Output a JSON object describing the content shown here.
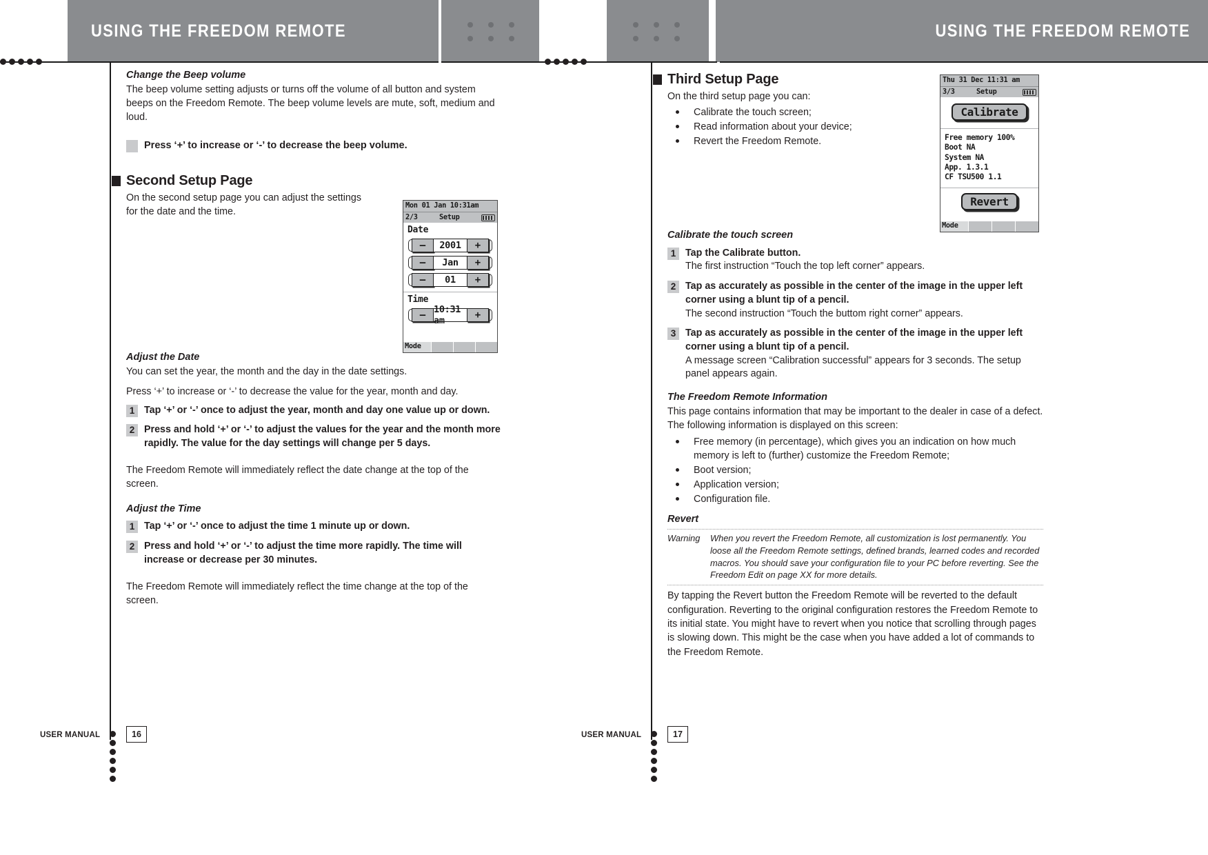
{
  "header": {
    "left_title": "USING THE FREEDOM REMOTE",
    "right_title": "USING THE FREEDOM REMOTE"
  },
  "left_page": {
    "beep": {
      "heading": "Change the Beep volume",
      "paragraph": "The beep volume setting adjusts or turns off the volume of all button and system beeps on the Freedom Remote. The beep volume levels are mute, soft, medium and loud.",
      "note": "Press ‘+’ to increase or ‘-’ to decrease the beep volume."
    },
    "second_setup": {
      "heading": "Second Setup Page",
      "paragraph": "On the second setup page you can adjust the settings for the date and the time."
    },
    "adjust_date": {
      "heading": "Adjust the Date",
      "paragraph1": "You can set the year, the month and the day in the date settings.",
      "paragraph2": "Press ‘+’ to increase or ‘-’ to decrease the value for the year, month and day.",
      "steps": [
        {
          "num": "1",
          "lead": "Tap ‘+’ or ‘-’ once to adjust the year, month and day one value up or down."
        },
        {
          "num": "2",
          "lead": "Press and hold ‘+’ or ‘-’ to adjust the values for the year and the month more rapidly. The value for the day settings will change per 5 days."
        }
      ],
      "closing": "The Freedom Remote will immediately reflect the date change at the top of the screen."
    },
    "adjust_time": {
      "heading": "Adjust the Time",
      "steps": [
        {
          "num": "1",
          "lead": "Tap ‘+’ or ‘-’ once to adjust the time 1 minute up or down."
        },
        {
          "num": "2",
          "lead": "Press and hold ‘+’ or ‘-’ to adjust the time more rapidly. The time will increase or decrease per 30 minutes."
        }
      ],
      "closing": "The Freedom Remote will immediately reflect the time change at the top of the screen."
    },
    "lcd": {
      "statusbar": "Mon 01 Jan  10:31am",
      "page_indicator": "2/3",
      "page_title": "Setup",
      "date_label": "Date",
      "year": "2001",
      "month": "Jan",
      "day": "01",
      "time_label": "Time",
      "time": "10:31 am",
      "minus": "–",
      "plus": "+",
      "mode": "Mode"
    }
  },
  "right_page": {
    "third_setup": {
      "heading": "Third Setup Page",
      "paragraph": "On the third setup page you can:",
      "bullets": [
        "Calibrate the touch screen;",
        "Read information about your device;",
        "Revert the Freedom Remote."
      ]
    },
    "calibrate": {
      "heading": "Calibrate the touch screen",
      "steps": [
        {
          "num": "1",
          "lead": "Tap the Calibrate button.",
          "sub": "The first instruction “Touch the top left corner” appears."
        },
        {
          "num": "2",
          "lead": "Tap as accurately as possible in the center of the image in the upper left corner using a blunt tip of a pencil.",
          "sub": "The second instruction “Touch the buttom right corner” appears."
        },
        {
          "num": "3",
          "lead": "Tap as accurately as possible in the center of the image in the upper left corner using a blunt tip of a pencil.",
          "sub": "A message screen “Calibration successful” appears for 3 seconds. The setup panel appears again."
        }
      ]
    },
    "information": {
      "heading": "The Freedom Remote Information",
      "paragraph": "This page contains information that may be important to the dealer in case of a defect. The following information is displayed on this screen:",
      "bullets": [
        "Free memory (in percentage), which gives you an indication on how much memory is left to (further) customize the Freedom Remote;",
        "Boot version;",
        "Application version;",
        "Configuration file."
      ]
    },
    "revert": {
      "heading": "Revert",
      "warning_label": "Warning",
      "warning_text": "When you revert the Freedom Remote, all customization is lost permanently. You loose all the Freedom Remote settings, defined brands, learned codes and recorded macros. You should save your configuration file to your PC before reverting. See the Freedom Edit on page XX for more details.",
      "paragraph": "By tapping the Revert button the Freedom Remote will be reverted to the default configuration. Reverting to the original configuration restores the Freedom Remote to its initial state. You might have to revert when you notice that scrolling through pages is slowing down. This might be the case when you have added a lot of commands to the Freedom Remote."
    },
    "lcd": {
      "statusbar": "Thu 31 Dec  11:31 am",
      "page_indicator": "3/3",
      "page_title": "Setup",
      "calibrate_button": "Calibrate",
      "info_lines": [
        "Free memory 100%",
        "Boot NA",
        "System NA",
        "App. 1.3.1",
        "CF TSU500 1.1"
      ],
      "revert_button": "Revert",
      "mode": "Mode"
    }
  },
  "footer": {
    "left_label": "USER MANUAL",
    "left_page_number": "16",
    "right_label": "USER MANUAL",
    "right_page_number": "17"
  },
  "colors": {
    "header_band": "#8a8c8f",
    "ink": "#231f20",
    "grey_marker": "#c9cacc",
    "lcd_bar": "#bfc1c3"
  }
}
